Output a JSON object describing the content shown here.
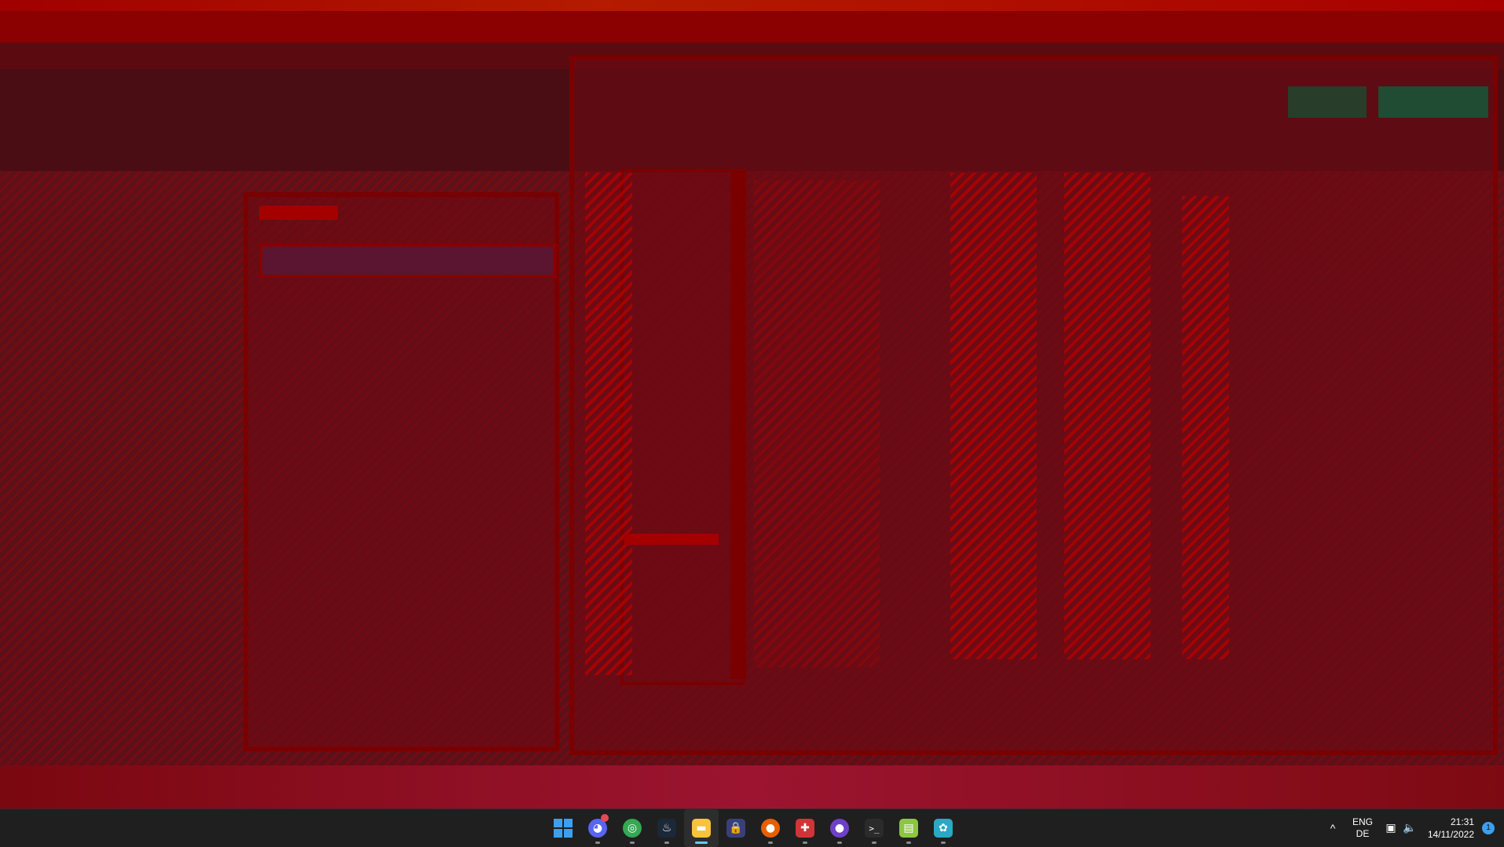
{
  "taskbar": {
    "apps": [
      {
        "name": "start",
        "icon": "windows-logo-icon"
      },
      {
        "name": "discord",
        "icon": "discord-icon",
        "color": "#5865f2",
        "glyph": "◕",
        "badge": true
      },
      {
        "name": "chrome",
        "icon": "chrome-icon",
        "color": "#34a853",
        "glyph": "◎"
      },
      {
        "name": "steam",
        "icon": "steam-icon",
        "color": "#1b2838",
        "glyph": "♨"
      },
      {
        "name": "file-explorer",
        "icon": "folder-icon",
        "color": "#f8c33a",
        "glyph": "▬",
        "active": true
      },
      {
        "name": "vpn",
        "icon": "lock-icon",
        "color": "#3a3f7a",
        "glyph": "🔒"
      },
      {
        "name": "firefox",
        "icon": "firefox-icon",
        "color": "#e66000",
        "glyph": "●"
      },
      {
        "name": "app-red",
        "icon": "red-app-icon",
        "color": "#d13438",
        "glyph": "✚"
      },
      {
        "name": "github-desktop",
        "icon": "github-icon",
        "color": "#6e40c9",
        "glyph": "●"
      },
      {
        "name": "terminal",
        "icon": "terminal-icon",
        "color": "#2b2b2b",
        "glyph": ">_"
      },
      {
        "name": "notepad",
        "icon": "notepad-icon",
        "color": "#8dc63f",
        "glyph": "▤"
      },
      {
        "name": "paint",
        "icon": "palette-icon",
        "color": "#2aa8c4",
        "glyph": "✿"
      }
    ],
    "tray": {
      "lang_line1": "ENG",
      "lang_line2": "DE",
      "time": "21:31",
      "date": "14/11/2022",
      "notification_count": "1"
    }
  }
}
